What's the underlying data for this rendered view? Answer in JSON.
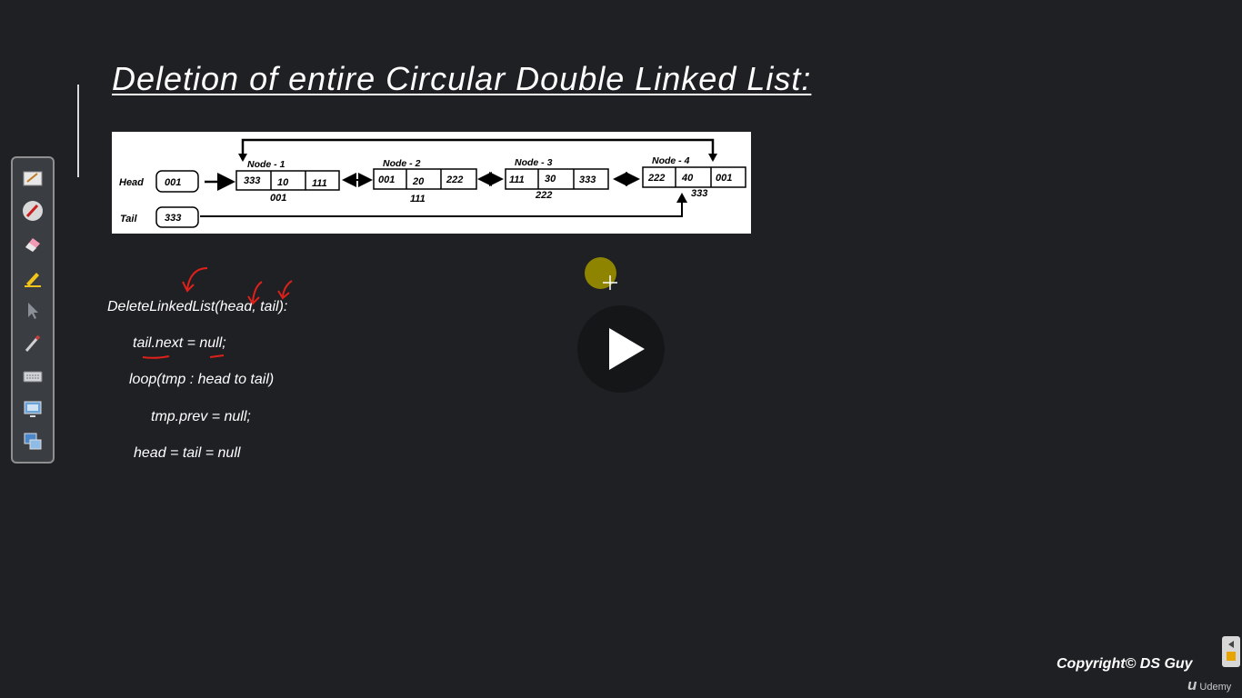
{
  "slide": {
    "title": "Deletion of entire Circular Double Linked List:"
  },
  "diagram": {
    "head_label": "Head",
    "head_value": "001",
    "tail_label": "Tail",
    "tail_value": "333",
    "nodes": [
      {
        "label": "Node - 1",
        "prev": "333",
        "data": "10",
        "next": "111",
        "address": "001"
      },
      {
        "label": "Node - 2",
        "prev": "001",
        "data": "20",
        "next": "222",
        "address": "111"
      },
      {
        "label": "Node - 3",
        "prev": "111",
        "data": "30",
        "next": "333",
        "address": "222"
      },
      {
        "label": "Node - 4",
        "prev": "222",
        "data": "40",
        "next": "001",
        "address": "333"
      }
    ]
  },
  "code": {
    "line1": "DeleteLinkedList(head, tail):",
    "line2": "tail.next = null;",
    "line3": "loop(tmp : head to tail)",
    "line4": "tmp.prev = null;",
    "line5": "head = tail = null"
  },
  "toolbar": {
    "tools": [
      "whiteboard-icon",
      "pen-icon",
      "eraser-icon",
      "highlighter-icon",
      "pointer-icon",
      "brush-icon",
      "keyboard-icon",
      "screen-capture-icon",
      "switch-screen-icon"
    ]
  },
  "player": {
    "play_icon": "play-icon"
  },
  "footer": {
    "copyright": "Copyright© DS Guy",
    "brand": "Udemy",
    "brand_mark": "u"
  },
  "colors": {
    "background": "#1e2023",
    "annotation": "#e0201a",
    "cursor_highlight": "#8f8400"
  }
}
